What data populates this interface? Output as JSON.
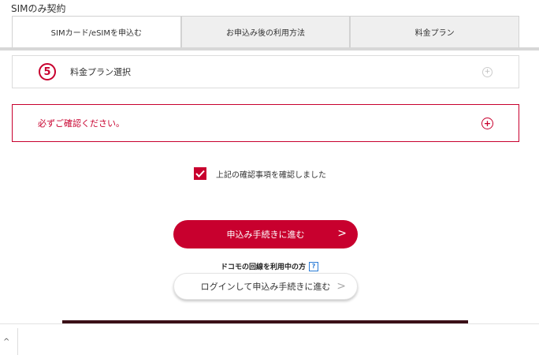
{
  "page": {
    "title": "SIMのみ契約"
  },
  "tabs": [
    {
      "label": "SIMカード/eSIMを申込む"
    },
    {
      "label": "お申込み後の利用方法"
    },
    {
      "label": "料金プラン"
    }
  ],
  "step": {
    "number": "5",
    "label": "料金プラン選択"
  },
  "notice": {
    "text": "必ずご確認ください。"
  },
  "confirm": {
    "label": "上記の確認事項を確認しました",
    "checked": true
  },
  "buttons": {
    "proceed_label": "申込み手続きに進む",
    "login_label": "ログインして申込み手続きに進む",
    "chevron": ">"
  },
  "docomo": {
    "text": "ドコモの回線を利用中の方",
    "help": "?"
  },
  "colors": {
    "accent": "#c8002e",
    "help": "#2a7bd6"
  },
  "icons": {
    "up": "^",
    "plus": "+"
  }
}
